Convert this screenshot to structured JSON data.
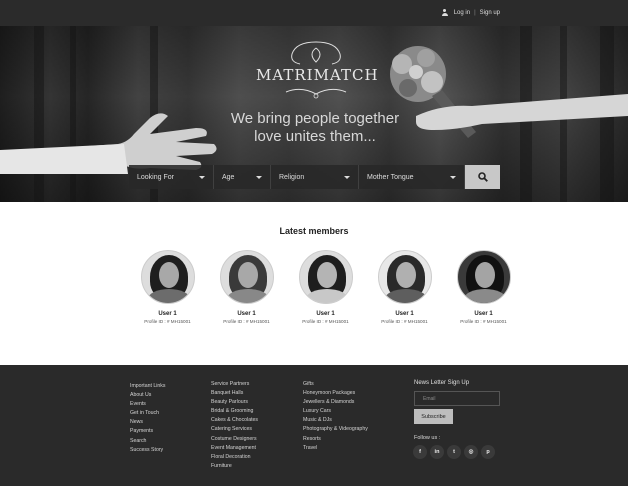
{
  "topbar": {
    "login": "Log in",
    "separator": "|",
    "signup": "Sign up"
  },
  "hero": {
    "logo_text": "MATRIMATCH",
    "tagline_line1": "We bring people together",
    "tagline_line2": "love unites them..."
  },
  "search": {
    "fields": [
      {
        "label": "Looking For"
      },
      {
        "label": "Age"
      },
      {
        "label": "Religion"
      },
      {
        "label": "Mother Tongue"
      }
    ],
    "button_icon": "search-icon"
  },
  "members": {
    "title": "Latest members",
    "items": [
      {
        "name": "User 1",
        "profile_id": "Profile ID : # MH15001"
      },
      {
        "name": "User 1",
        "profile_id": "Profile ID : # MH15001"
      },
      {
        "name": "User 1",
        "profile_id": "Profile ID : # MH15001"
      },
      {
        "name": "User 1",
        "profile_id": "Profile ID : # MH15001"
      },
      {
        "name": "User 1",
        "profile_id": "Profile ID : # MH15001"
      }
    ]
  },
  "footer": {
    "links": [
      "Important Links",
      "About Us",
      "Events",
      "Get in Touch",
      "News",
      "Payments",
      "Search",
      "Success Story"
    ],
    "services": [
      "Service Partners",
      "Banquet Halls",
      "Beauty Parlours",
      "Bridal & Grooming",
      "Cakes & Chocolates",
      "Catering Services",
      "Costume Designers",
      "Event Management",
      "Floral Decoration",
      "Furniture"
    ],
    "gifts": [
      "Gifts",
      "Honeymoon Packages",
      "Jewellers & Diamonds",
      "Luxury Cars",
      "Music & DJs",
      "Photography & Videography",
      "Resorts",
      "Travel"
    ],
    "newsletter": {
      "title": "News Letter Sign Up",
      "email_placeholder": "Email",
      "subscribe": "Subscribe",
      "follow": "Follow us :"
    },
    "socials": [
      {
        "icon": "facebook-icon",
        "glyph": "f"
      },
      {
        "icon": "linkedin-icon",
        "glyph": "in"
      },
      {
        "icon": "twitter-icon",
        "glyph": "t"
      },
      {
        "icon": "dribbble-icon",
        "glyph": "◎"
      },
      {
        "icon": "pinterest-icon",
        "glyph": "p"
      }
    ]
  }
}
